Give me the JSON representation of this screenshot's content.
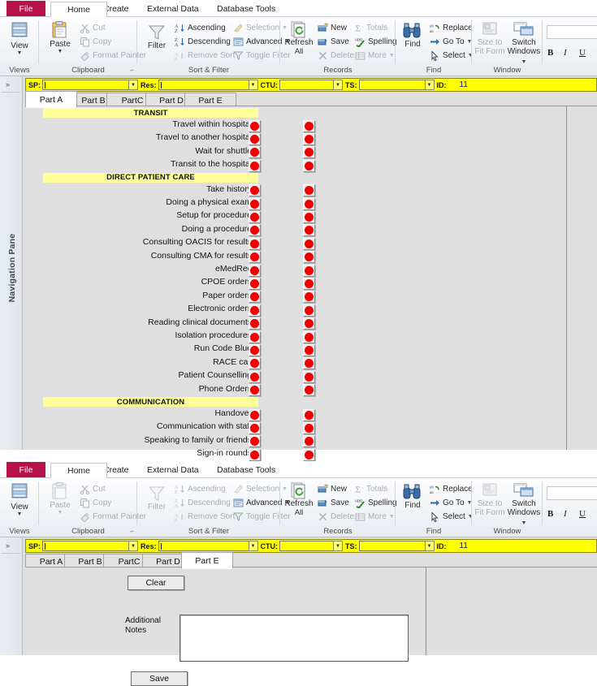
{
  "ribbon": {
    "file_tab": "File",
    "tabs": [
      {
        "label": "Home",
        "active": true
      },
      {
        "label": "Create",
        "active": false
      },
      {
        "label": "External Data",
        "active": false
      },
      {
        "label": "Database Tools",
        "active": false
      }
    ],
    "groups": [
      {
        "name": "Views",
        "label": "Views"
      },
      {
        "name": "Clipboard",
        "label": "Clipboard"
      },
      {
        "name": "Sort & Filter",
        "label": "Sort & Filter"
      },
      {
        "name": "Records",
        "label": "Records"
      },
      {
        "name": "Find",
        "label": "Find"
      },
      {
        "name": "Window",
        "label": "Window"
      }
    ],
    "views": {
      "big_label": "View"
    },
    "clipboard": {
      "paste": "Paste",
      "cut": "Cut",
      "copy": "Copy",
      "format_painter": "Format Painter"
    },
    "sortfilter": {
      "filter": "Filter",
      "ascending": "Ascending",
      "descending": "Descending",
      "remove_sort": "Remove Sort",
      "selection": "Selection",
      "advanced": "Advanced",
      "toggle_filter": "Toggle Filter"
    },
    "records": {
      "refresh_all": "Refresh\nAll",
      "refresh_line1": "Refresh",
      "refresh_line2": "All",
      "new": "New",
      "save": "Save",
      "delete": "Delete",
      "totals": "Totals",
      "spelling": "Spelling",
      "more": "More"
    },
    "find": {
      "find": "Find",
      "replace": "Replace",
      "goto": "Go To",
      "select": "Select"
    },
    "window": {
      "size_to_fit_line1": "Size to",
      "size_to_fit_line2": "Fit Form",
      "switch_line1": "Switch",
      "switch_line2": "Windows"
    },
    "text_format": {
      "bold": "B",
      "italic": "I",
      "underline": "U"
    }
  },
  "navigation_pane": {
    "label": "Navigation Pane",
    "expand_chevron": "»"
  },
  "form_header": {
    "sp_label": "SP:",
    "sp_value": "",
    "res_label": "Res:",
    "res_value": "",
    "ctu_label": "CTU:",
    "ctu_value": "",
    "ts_label": "TS:",
    "ts_value": "",
    "id_label": "ID:",
    "id_value": "11"
  },
  "part_tabs": [
    {
      "label": "Part A"
    },
    {
      "label": "Part B"
    },
    {
      "label": "PartC"
    },
    {
      "label": "Part D"
    },
    {
      "label": "Part E"
    }
  ],
  "window_top": {
    "active_part_tab": "Part A",
    "sections": [
      {
        "heading": "TRANSIT",
        "items": [
          {
            "label": "Travel within hospital",
            "start_state": "red",
            "stop_state": "red"
          },
          {
            "label": "Travel to another hospital",
            "start_state": "red",
            "stop_state": "red"
          },
          {
            "label": "Wait for shuttle",
            "start_state": "red",
            "stop_state": "red"
          },
          {
            "label": "Transit to the hospital",
            "start_state": "red",
            "stop_state": "red"
          }
        ]
      },
      {
        "heading": "DIRECT PATIENT CARE",
        "items": [
          {
            "label": "Take history",
            "start_state": "red",
            "stop_state": "red"
          },
          {
            "label": "Doing a physical exam",
            "start_state": "red",
            "stop_state": "red"
          },
          {
            "label": "Setup for procedure",
            "start_state": "red",
            "stop_state": "red"
          },
          {
            "label": "Doing a procedure",
            "start_state": "red",
            "stop_state": "red"
          },
          {
            "label": "Consulting OACIS for results",
            "start_state": "red",
            "stop_state": "red"
          },
          {
            "label": "Consulting CMA for results",
            "start_state": "red",
            "stop_state": "red"
          },
          {
            "label": "eMedRec",
            "start_state": "red",
            "stop_state": "red"
          },
          {
            "label": "CPOE orders",
            "start_state": "red",
            "stop_state": "red"
          },
          {
            "label": "Paper orders",
            "start_state": "red",
            "stop_state": "red"
          },
          {
            "label": "Electronic orders",
            "start_state": "red",
            "stop_state": "red"
          },
          {
            "label": "Reading clinical documents",
            "start_state": "red",
            "stop_state": "red"
          },
          {
            "label": "Isolation procedures",
            "start_state": "red",
            "stop_state": "red"
          },
          {
            "label": "Run Code Blue",
            "start_state": "red",
            "stop_state": "red"
          },
          {
            "label": "RACE call",
            "start_state": "red",
            "stop_state": "red"
          },
          {
            "label": "Patient Counselling",
            "start_state": "red",
            "stop_state": "red"
          },
          {
            "label": "Phone Orders",
            "start_state": "red",
            "stop_state": "red"
          }
        ]
      },
      {
        "heading": "COMMUNICATION",
        "items": [
          {
            "label": "Handover",
            "start_state": "red",
            "stop_state": "red"
          },
          {
            "label": "Communication with staff",
            "start_state": "red",
            "stop_state": "red"
          },
          {
            "label": "Speaking to family or friends",
            "start_state": "red",
            "stop_state": "red"
          },
          {
            "label": "Sign-in rounds",
            "start_state": "red",
            "stop_state": "red"
          }
        ]
      }
    ]
  },
  "window_bottom": {
    "active_part_tab": "Part E",
    "clear_button": "Clear",
    "additional_notes_label_line1": "Additional",
    "additional_notes_label_line2": "Notes",
    "additional_notes_value": "",
    "save_button": "Save"
  },
  "colors": {
    "file_tab": "#b8124a",
    "header_band": "#ffff00",
    "section_band": "#ffff99",
    "indicator_red": "#f00000",
    "form_background": "#dfdfdf"
  }
}
